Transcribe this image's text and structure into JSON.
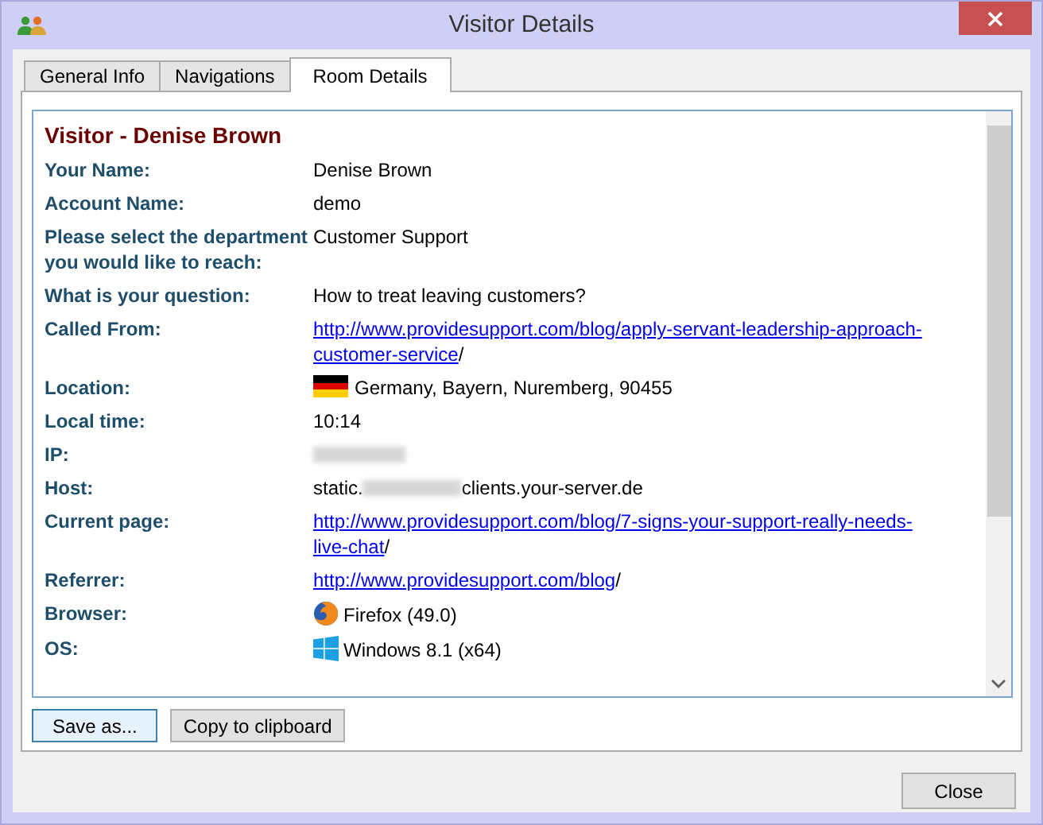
{
  "window": {
    "title": "Visitor Details"
  },
  "tabs": [
    {
      "label": "General Info",
      "selected": false
    },
    {
      "label": "Navigations",
      "selected": false
    },
    {
      "label": "Room Details",
      "selected": true
    }
  ],
  "details": {
    "heading": "Visitor - Denise Brown",
    "rows": [
      {
        "label": "Your Name:",
        "kind": "text",
        "value": "Denise Brown"
      },
      {
        "label": "Account Name:",
        "kind": "text",
        "value": "demo"
      },
      {
        "label": "Please select the department you would like to reach:",
        "kind": "text",
        "value": "Customer Support"
      },
      {
        "label": "What is your question:",
        "kind": "text",
        "value": "How to treat leaving customers?"
      },
      {
        "label": "Called From:",
        "kind": "link",
        "lines": [
          "http://www.providesupport.com/blog/apply-servant-leadership-approach-",
          "customer-service"
        ],
        "suffix": "/"
      },
      {
        "label": "Location:",
        "kind": "flag",
        "value": "Germany, Bayern, Nuremberg, 90455"
      },
      {
        "label": "Local time:",
        "kind": "text",
        "value": "10:14"
      },
      {
        "label": "IP:",
        "kind": "redacted"
      },
      {
        "label": "Host:",
        "kind": "host",
        "value": "static.",
        "suffix": "clients.your-server.de"
      },
      {
        "label": "Current page:",
        "kind": "link",
        "lines": [
          "http://www.providesupport.com/blog/7-signs-your-support-really-needs-",
          "live-chat"
        ],
        "suffix": "/"
      },
      {
        "label": "Referrer:",
        "kind": "link",
        "lines": [
          "http://www.providesupport.com/blog"
        ],
        "suffix": "/"
      },
      {
        "label": "Browser:",
        "kind": "browser",
        "value": "Firefox (49.0)"
      },
      {
        "label": "OS:",
        "kind": "os",
        "value": "Windows 8.1 (x64)"
      }
    ]
  },
  "panel_buttons": [
    "Save as...",
    "Copy to clipboard"
  ],
  "footer_button": "Close"
}
